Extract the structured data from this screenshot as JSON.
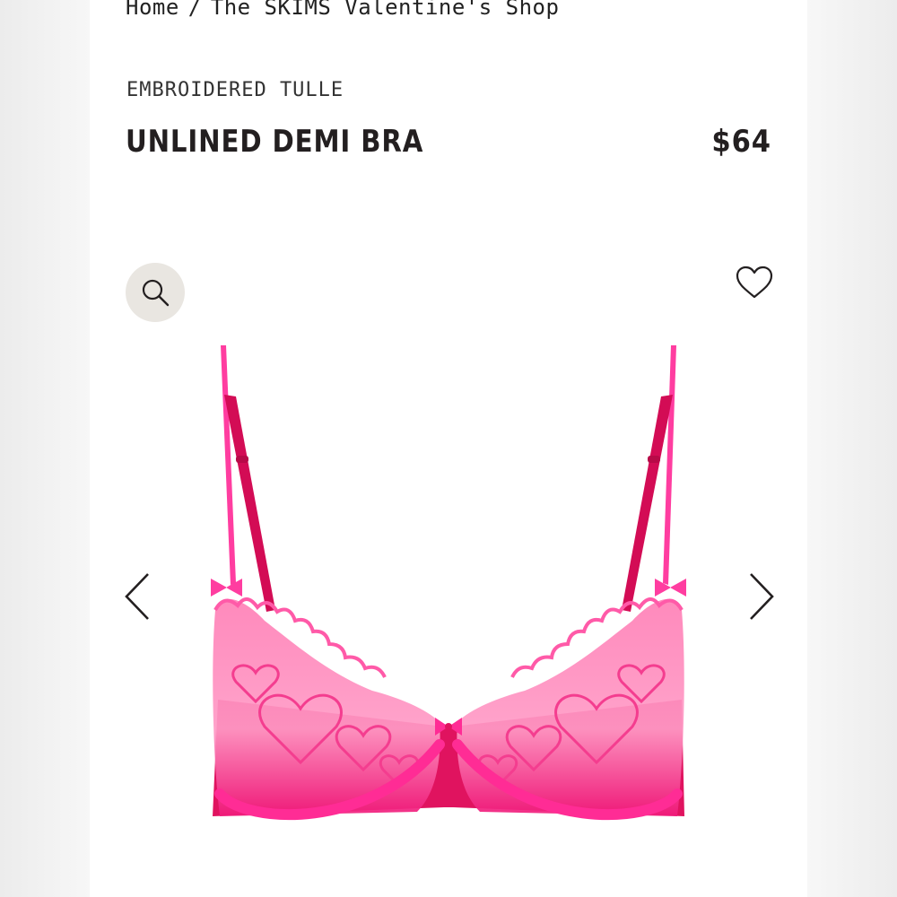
{
  "breadcrumb": {
    "home": "Home",
    "separator": "/",
    "current": "The SKIMS Valentine's Shop"
  },
  "product": {
    "collection": "EMBROIDERED TULLE",
    "name": "UNLINED DEMI BRA",
    "price": "$64",
    "image_alt": "Pink embroidered tulle unlined demi bra with heart embroidery"
  },
  "icons": {
    "zoom": "search-icon",
    "wishlist": "heart-outline-icon",
    "prev": "chevron-left-icon",
    "next": "chevron-right-icon"
  },
  "colors": {
    "text": "#231f20",
    "zoom_bg": "#e9e6e1",
    "product_pink": "#f0197a"
  }
}
